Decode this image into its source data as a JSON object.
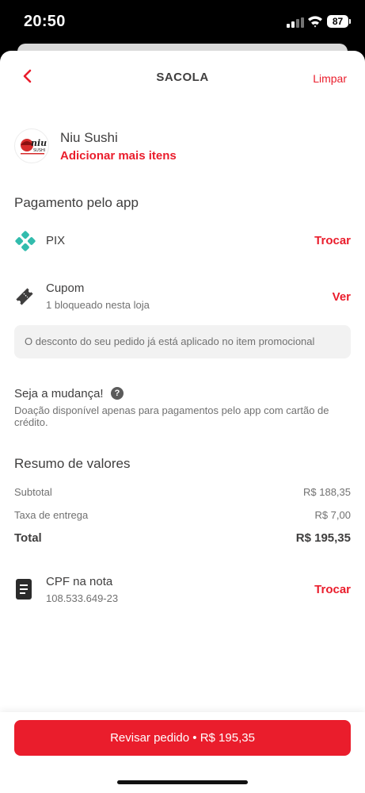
{
  "status_bar": {
    "time": "20:50",
    "battery": "87"
  },
  "header": {
    "title": "SACOLA",
    "clear_label": "Limpar"
  },
  "store": {
    "name": "Niu Sushi",
    "add_items_label": "Adicionar mais itens",
    "logo_text": "niu SUSHI"
  },
  "payment": {
    "section_title": "Pagamento pelo app",
    "method": "PIX",
    "change_label": "Trocar"
  },
  "coupon": {
    "title": "Cupom",
    "subtitle": "1 bloqueado nesta loja",
    "action_label": "Ver",
    "info": "O desconto do seu pedido já está aplicado no item promocional"
  },
  "donation": {
    "title": "Seja a mudança!",
    "help": "?",
    "text": "Doação disponível apenas para pagamentos pelo app com cartão de crédito."
  },
  "summary": {
    "title": "Resumo de valores",
    "subtotal_label": "Subtotal",
    "subtotal_value": "R$ 188,35",
    "delivery_label": "Taxa de entrega",
    "delivery_value": "R$ 7,00",
    "total_label": "Total",
    "total_value": "R$ 195,35"
  },
  "cpf": {
    "title": "CPF na nota",
    "value": "108.533.649-23",
    "change_label": "Trocar"
  },
  "footer": {
    "cta_label": "Revisar pedido • R$ 195,35"
  },
  "colors": {
    "accent": "#ea1d2c",
    "pix": "#32bcad",
    "text": "#3f3e3e",
    "muted": "#717171"
  }
}
